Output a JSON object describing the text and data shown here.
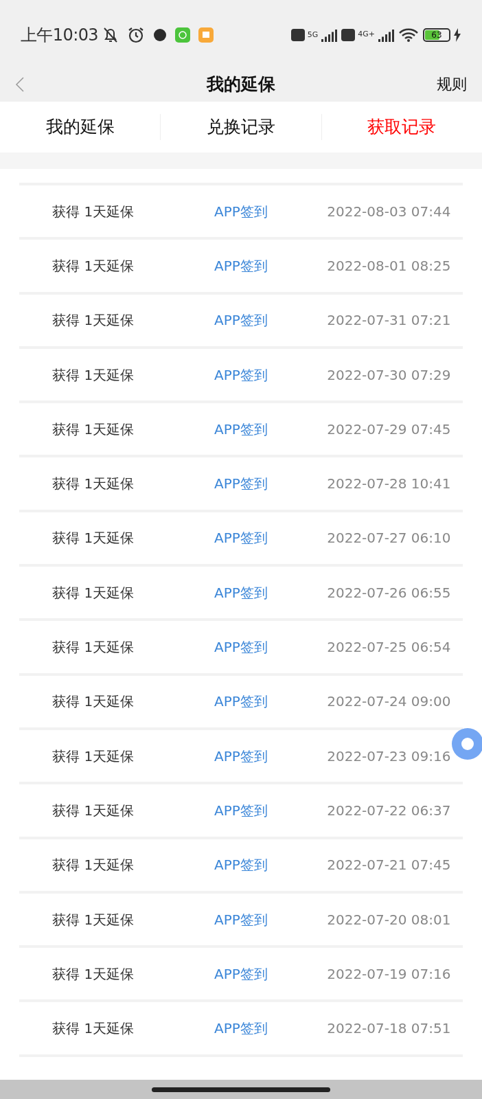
{
  "status_bar": {
    "time": "上午10:03",
    "network_1": "5G",
    "network_2": "4G+",
    "battery": "63"
  },
  "header": {
    "title": "我的延保",
    "action": "规则"
  },
  "tabs": [
    {
      "label": "我的延保",
      "selected": false
    },
    {
      "label": "兑换记录",
      "selected": false
    },
    {
      "label": "获取记录",
      "selected": true
    }
  ],
  "records": [
    {
      "reward": "获得 1天延保",
      "source": "APP签到",
      "time": "2022-08-03 07:44"
    },
    {
      "reward": "获得 1天延保",
      "source": "APP签到",
      "time": "2022-08-01 08:25"
    },
    {
      "reward": "获得 1天延保",
      "source": "APP签到",
      "time": "2022-07-31 07:21"
    },
    {
      "reward": "获得 1天延保",
      "source": "APP签到",
      "time": "2022-07-30 07:29"
    },
    {
      "reward": "获得 1天延保",
      "source": "APP签到",
      "time": "2022-07-29 07:45"
    },
    {
      "reward": "获得 1天延保",
      "source": "APP签到",
      "time": "2022-07-28 10:41"
    },
    {
      "reward": "获得 1天延保",
      "source": "APP签到",
      "time": "2022-07-27 06:10"
    },
    {
      "reward": "获得 1天延保",
      "source": "APP签到",
      "time": "2022-07-26 06:55"
    },
    {
      "reward": "获得 1天延保",
      "source": "APP签到",
      "time": "2022-07-25 06:54"
    },
    {
      "reward": "获得 1天延保",
      "source": "APP签到",
      "time": "2022-07-24 09:00"
    },
    {
      "reward": "获得 1天延保",
      "source": "APP签到",
      "time": "2022-07-23 09:16"
    },
    {
      "reward": "获得 1天延保",
      "source": "APP签到",
      "time": "2022-07-22 06:37"
    },
    {
      "reward": "获得 1天延保",
      "source": "APP签到",
      "time": "2022-07-21 07:45"
    },
    {
      "reward": "获得 1天延保",
      "source": "APP签到",
      "time": "2022-07-20 08:01"
    },
    {
      "reward": "获得 1天延保",
      "source": "APP签到",
      "time": "2022-07-19 07:16"
    },
    {
      "reward": "获得 1天延保",
      "source": "APP签到",
      "time": "2022-07-18 07:51"
    }
  ]
}
